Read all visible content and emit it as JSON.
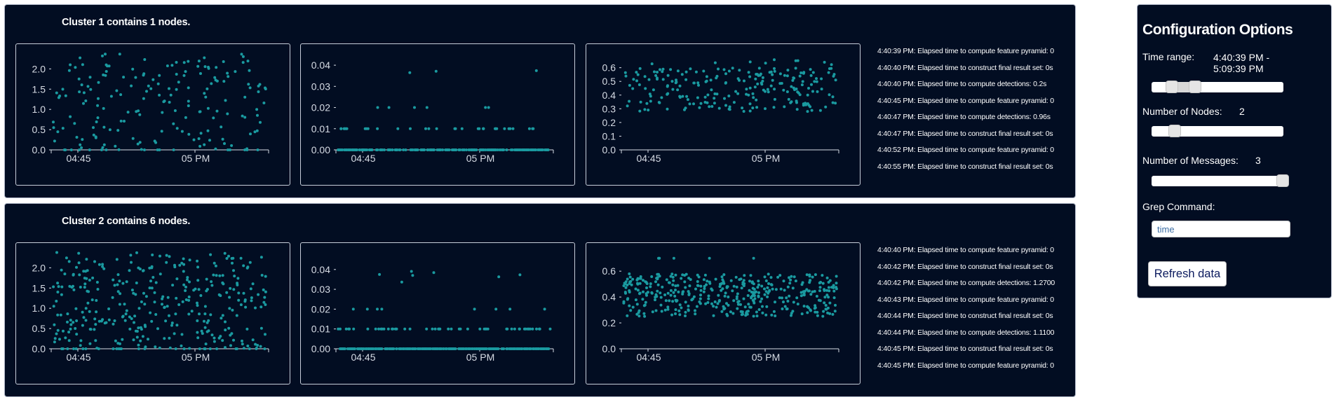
{
  "clusters": [
    {
      "title": "Cluster 1 contains 1 nodes.",
      "charts": [
        {
          "y_ticks": [
            "0.0",
            "0.5",
            "1.0",
            "1.5",
            "2.0"
          ],
          "ylim": [
            0,
            2.3
          ],
          "x_ticks": [
            "04:45",
            "05 PM"
          ],
          "spread": "uniform",
          "count": 190
        },
        {
          "y_ticks": [
            "0.00",
            "0.01",
            "0.02",
            "0.03",
            "0.04"
          ],
          "ylim": [
            0,
            0.044
          ],
          "x_ticks": [
            "04:45",
            "05 PM"
          ],
          "spread": "sparse",
          "count": 260
        },
        {
          "y_ticks": [
            "0.0",
            "0.1",
            "0.2",
            "0.3",
            "0.4",
            "0.5",
            "0.6"
          ],
          "ylim": [
            0,
            0.68
          ],
          "x_ticks": [
            "04:45",
            "05 PM"
          ],
          "spread": "band",
          "count": 230
        }
      ],
      "log": [
        "4:40:39 PM: Elapsed time to compute feature pyramid: 0",
        "4:40:40 PM: Elapsed time to construct final result set: 0s",
        "4:40:40 PM: Elapsed time to compute detections: 0.2s",
        "4:40:45 PM: Elapsed time to compute feature pyramid: 0",
        "4:40:47 PM: Elapsed time to compute detections: 0.96s",
        "4:40:47 PM: Elapsed time to construct final result set: 0s",
        "4:40:52 PM: Elapsed time to compute feature pyramid: 0",
        "4:40:55 PM: Elapsed time to construct final result set: 0s"
      ]
    },
    {
      "title": "Cluster 2 contains 6 nodes.",
      "charts": [
        {
          "y_ticks": [
            "0.0",
            "0.5",
            "1.0",
            "1.5",
            "2.0"
          ],
          "ylim": [
            0,
            2.3
          ],
          "x_ticks": [
            "04:45",
            "05 PM"
          ],
          "spread": "uniform",
          "count": 360
        },
        {
          "y_ticks": [
            "0.00",
            "0.01",
            "0.02",
            "0.03",
            "0.04"
          ],
          "ylim": [
            0,
            0.047
          ],
          "x_ticks": [
            "04:45",
            "05 PM"
          ],
          "spread": "sparse",
          "count": 380
        },
        {
          "y_ticks": [
            "0.0",
            "0.2",
            "0.4",
            "0.6"
          ],
          "ylim": [
            0,
            0.72
          ],
          "x_ticks": [
            "04:45",
            "05 PM"
          ],
          "spread": "band2",
          "count": 420
        }
      ],
      "log": [
        "4:40:40 PM: Elapsed time to compute feature pyramid: 0",
        "4:40:42 PM: Elapsed time to construct final result set: 0s",
        "4:40:42 PM: Elapsed time to compute detections: 1.2700",
        "4:40:43 PM: Elapsed time to compute feature pyramid: 0",
        "4:40:44 PM: Elapsed time to construct final result set: 0s",
        "4:40:44 PM: Elapsed time to compute detections: 1.1100",
        "4:40:45 PM: Elapsed time to construct final result set: 0s",
        "4:40:45 PM: Elapsed time to compute feature pyramid: 0"
      ]
    }
  ],
  "config": {
    "title": "Configuration Options",
    "time_range_label": "Time range:",
    "time_range_value_line1": "4:40:39 PM -",
    "time_range_value_line2": "5:09:39 PM",
    "nodes_label": "Number of Nodes:",
    "nodes_value": "2",
    "messages_label": "Number of Messages:",
    "messages_value": "3",
    "grep_label": "Grep Command:",
    "grep_value": "time",
    "refresh_label": "Refresh data",
    "time_range_fraction": [
      0.12,
      0.31
    ],
    "nodes_fraction": 0.14,
    "messages_fraction": 1.0
  },
  "colors": {
    "background": "#020d22",
    "dot": "#1a9aa0",
    "text": "#ffffff",
    "axis": "#d8dde6"
  }
}
